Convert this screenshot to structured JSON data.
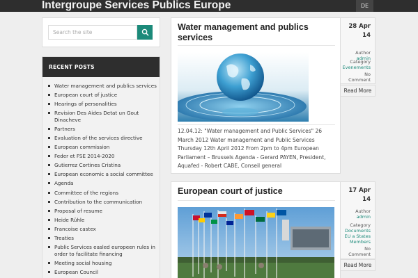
{
  "header": {
    "site_title": "Intergroupe Services Publics Europe",
    "lang": "DE"
  },
  "search": {
    "placeholder": "Search the site",
    "icon": "search-icon"
  },
  "recent_posts": {
    "heading": "RECENT POSTS",
    "items": [
      "Water management and publics services",
      "European court of justice",
      "Hearings of personalities",
      "Revision Des Aides Detat un Gout Dinacheve",
      "Partners",
      "Evaluation of the services directive",
      "European commission",
      "Feder et FSE 2014-2020",
      "Gutierrez Cortines Cristina",
      "European economic a social committee",
      "Agenda",
      "Committee of the regions",
      "Contribution to the communication",
      "Proposal of resume",
      "Heide Rühle",
      "Francoise castex",
      "Treaties",
      "Public Services easled europeen rules in order to facilitate financing",
      "Meeting social housing",
      "European Council"
    ]
  },
  "posts": [
    {
      "title": "Water management and publics services",
      "excerpt": "12.04.12: \"Water management and Public Services\" 26 March 2012 Water management and Public Services Thursday 12th April 2012 From 2pm to 4pm European Parliament – Brussels Agenda - Gerard PAYEN, President, Aquafed - Robert CABE, Conseil general",
      "date_day": "28 Apr",
      "date_year": "14",
      "author_label": "Author",
      "author": "admin",
      "category_label": "Category",
      "categories": [
        "Evenements"
      ],
      "comments": "No Comment",
      "read_more": "Read More"
    },
    {
      "title": "European court of justice",
      "date_day": "17 Apr",
      "date_year": "14",
      "author_label": "Author",
      "author": "admin",
      "category_label": "Category",
      "categories": [
        "Documents",
        "EU a States Members"
      ],
      "comments": "No Comment",
      "read_more": "Read More"
    }
  ],
  "colors": {
    "accent": "#1c8a7a",
    "dark_bar": "#2e2e2e",
    "background": "#eeeeee"
  }
}
